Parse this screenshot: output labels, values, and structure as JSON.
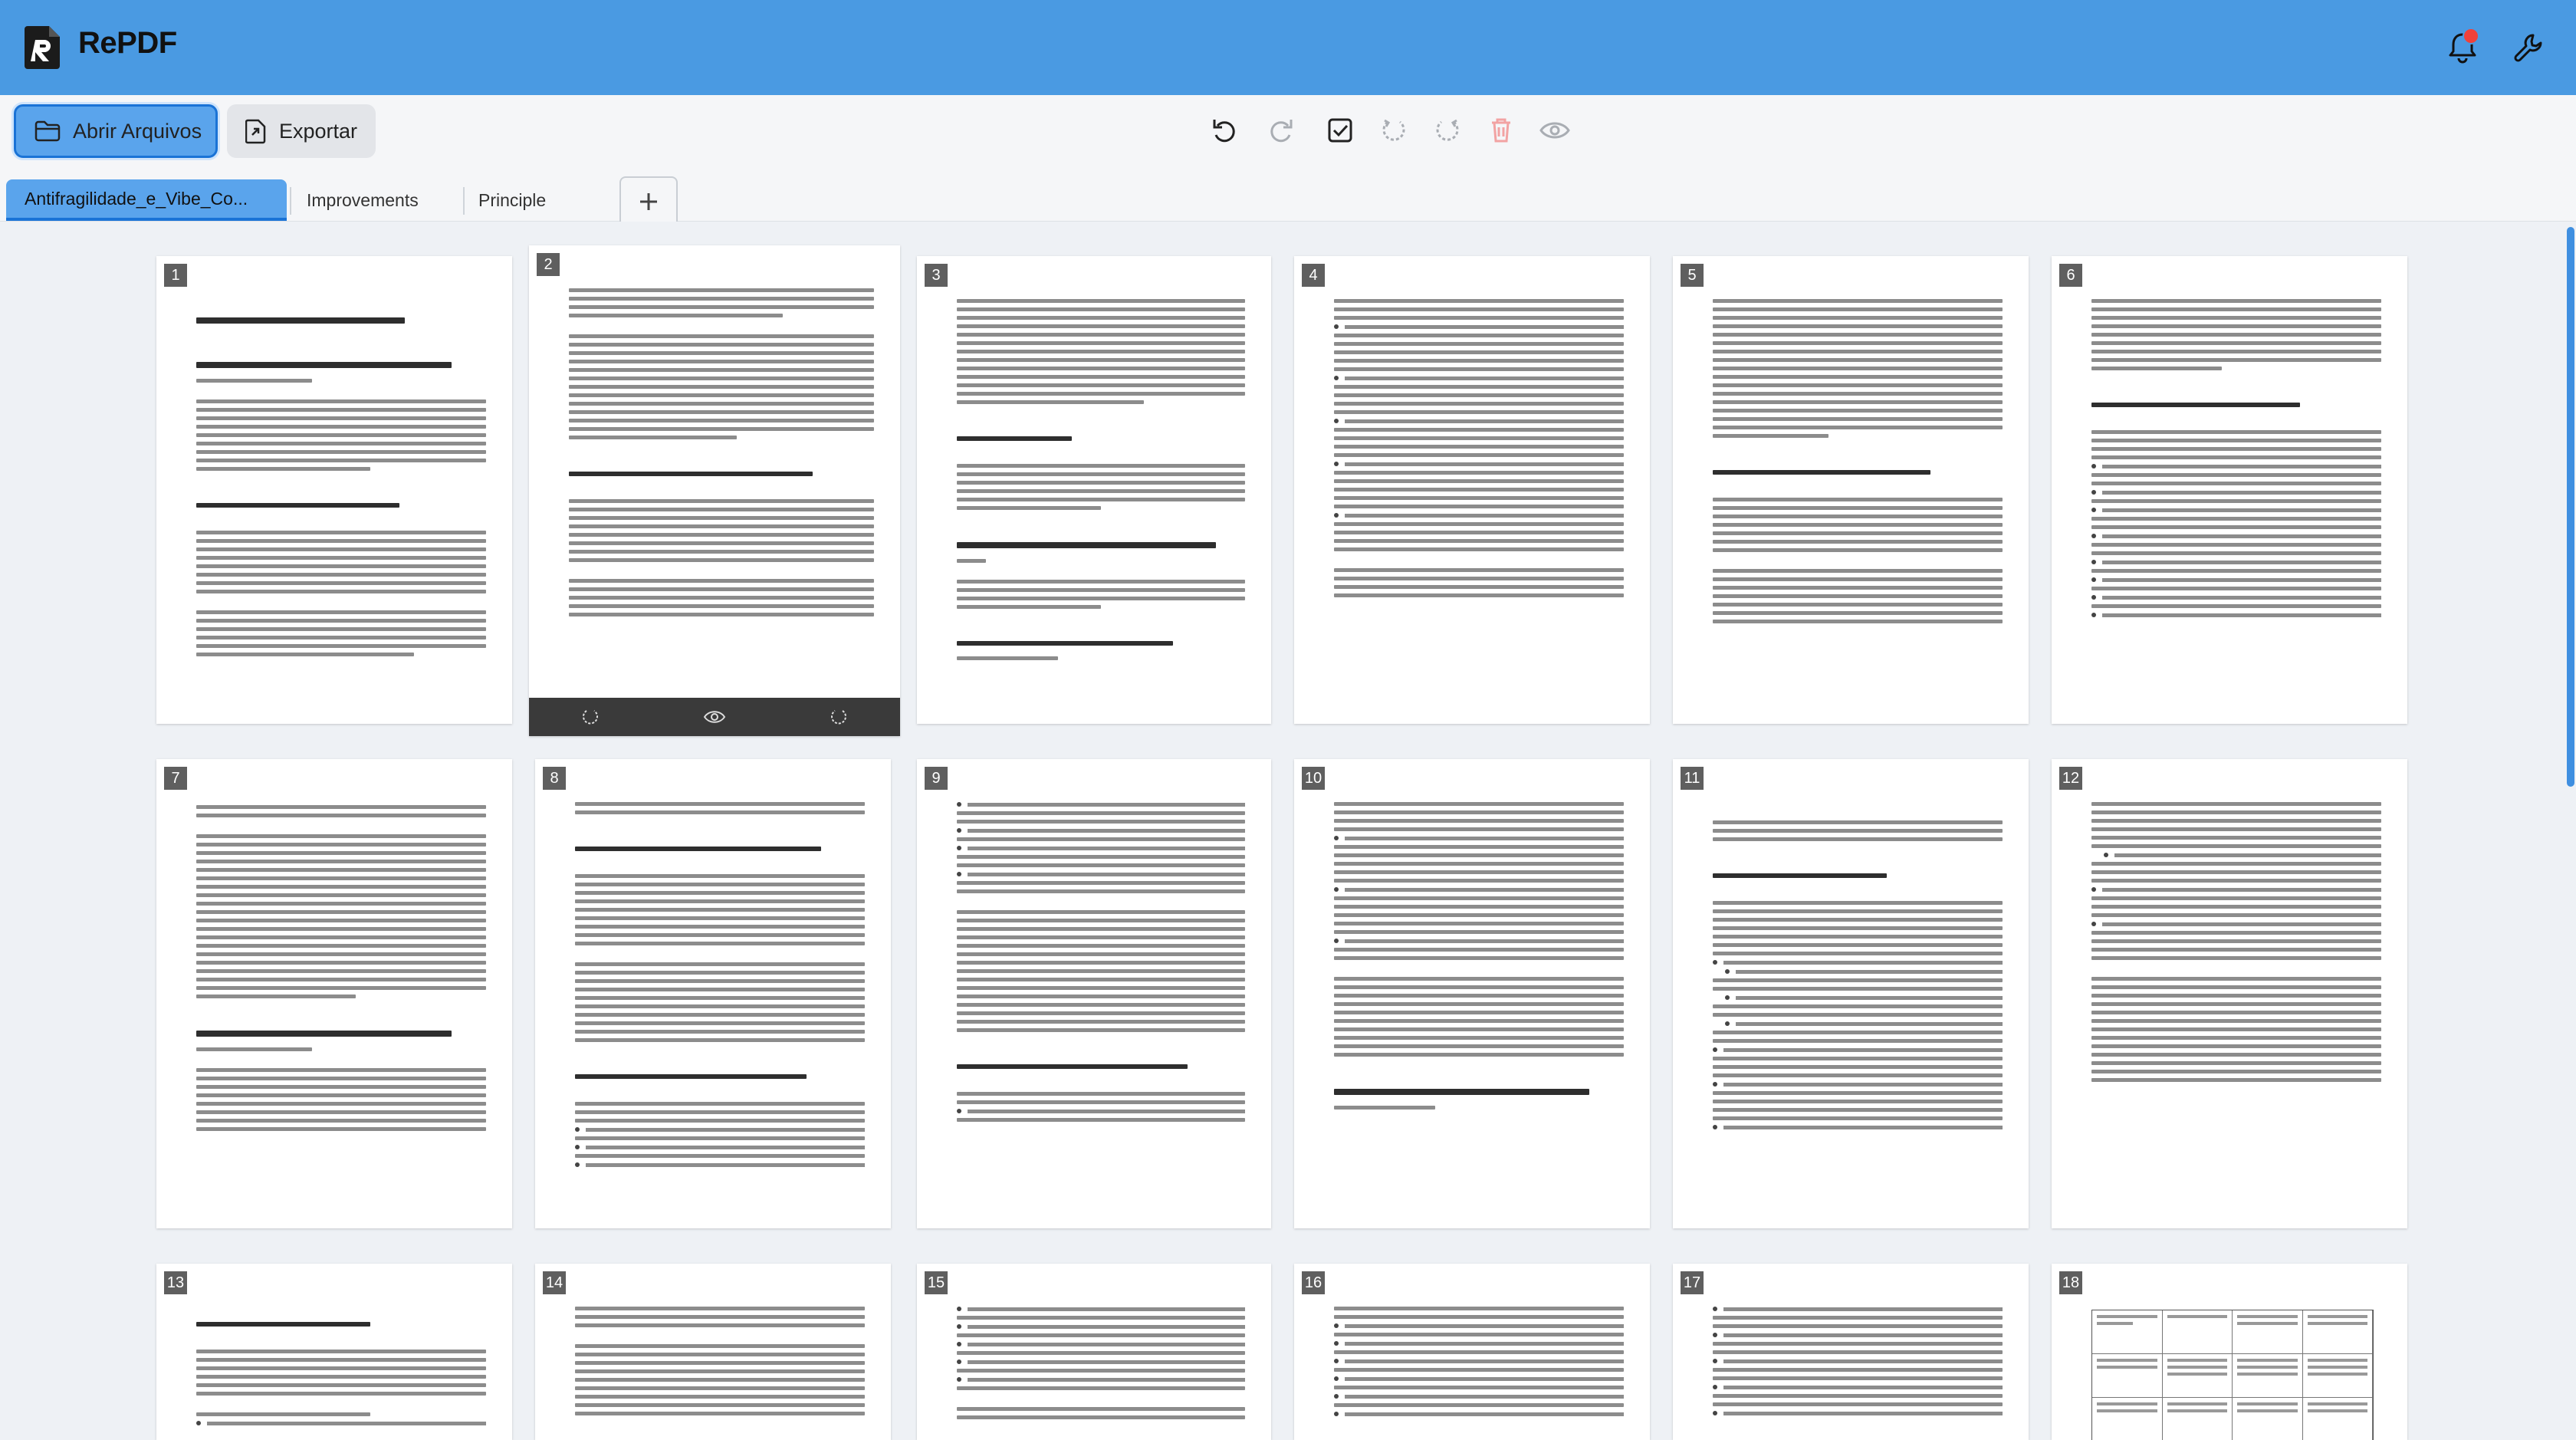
{
  "app": {
    "title": "RePDF"
  },
  "header": {
    "icons": [
      "bell-icon",
      "wrench-icon"
    ],
    "has_notification": true
  },
  "toolbar": {
    "open_label": "Abrir Arquivos",
    "export_label": "Exportar",
    "tools": [
      "undo-icon",
      "redo-icon",
      "select-all-icon",
      "rotate-left-icon",
      "rotate-right-icon",
      "delete-icon",
      "preview-icon"
    ]
  },
  "tabs": [
    {
      "label": "Antifragilidade_e_Vibe_Co...",
      "active": true
    },
    {
      "label": "Improvements",
      "active": false
    },
    {
      "label": "Principle",
      "active": false
    }
  ],
  "pages": [
    {
      "number": "1"
    },
    {
      "number": "2",
      "hovered": true
    },
    {
      "number": "3"
    },
    {
      "number": "4"
    },
    {
      "number": "5"
    },
    {
      "number": "6"
    },
    {
      "number": "7"
    },
    {
      "number": "8"
    },
    {
      "number": "9"
    },
    {
      "number": "10"
    },
    {
      "number": "11"
    },
    {
      "number": "12"
    },
    {
      "number": "13"
    },
    {
      "number": "14"
    },
    {
      "number": "15"
    },
    {
      "number": "16"
    },
    {
      "number": "17"
    },
    {
      "number": "18"
    }
  ],
  "colors": {
    "header": "#4a9ae2",
    "accent": "#1a73d6",
    "danger_disabled": "#f2a3a3"
  }
}
